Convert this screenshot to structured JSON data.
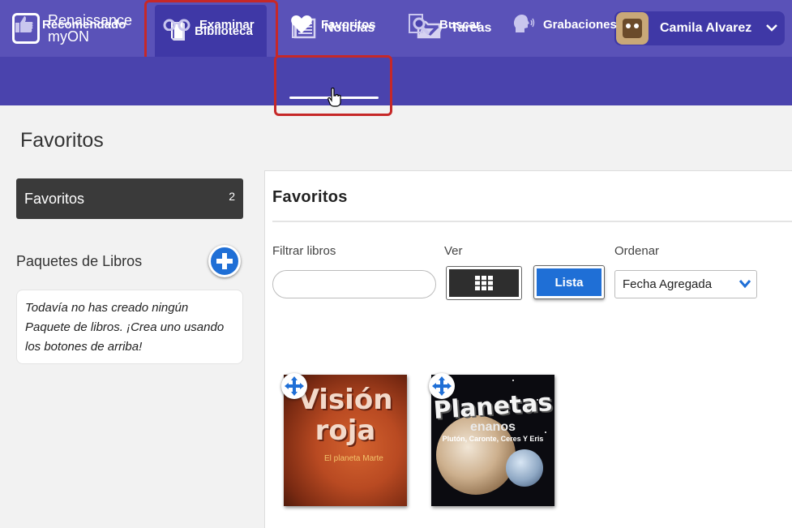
{
  "brand": {
    "line1": "Renaissance",
    "line2": "myON",
    "logo_letter": "m"
  },
  "topnav": {
    "items": [
      {
        "label": "Biblioteca",
        "icon": "book-icon"
      },
      {
        "label": "Noticias",
        "icon": "newspaper-icon"
      },
      {
        "label": "Tareas",
        "icon": "folder-icon"
      }
    ],
    "active": "Biblioteca"
  },
  "user": {
    "name": "Camila Alvarez",
    "icon": "chevron-down-icon"
  },
  "subnav": {
    "items": [
      {
        "label": "Recomendado",
        "icon": "thumbs-up-icon"
      },
      {
        "label": "Examinar",
        "icon": "glasses-icon"
      },
      {
        "label": "Favoritos",
        "icon": "heart-icon"
      },
      {
        "label": "Buscar",
        "icon": "search-icon"
      },
      {
        "label": "Grabaciones",
        "icon": "speaking-head-icon"
      }
    ],
    "active": "Favoritos"
  },
  "page": {
    "title": "Favoritos"
  },
  "sidebar": {
    "favorites": {
      "label": "Favoritos",
      "count": "2"
    },
    "packs": {
      "title": "Paquetes de Libros",
      "empty_text": "Todavía no has creado ningún Paquete de libros. ¡Crea uno usando los botones de arriba!"
    }
  },
  "main": {
    "title": "Favoritos",
    "filter": {
      "label": "Filtrar libros",
      "value": "",
      "placeholder": ""
    },
    "view": {
      "label": "Ver",
      "grid_icon": "grid-icon",
      "list_label": "Lista"
    },
    "sort": {
      "label": "Ordenar",
      "selected": "Fecha Agregada"
    }
  },
  "books": [
    {
      "title_line1": "Visión",
      "title_line2": "roja",
      "subtitle": "El planeta Marte"
    },
    {
      "title_line1": "Planetas",
      "title_line2": "enanos",
      "subtitle": "Plutón, Caronte, Ceres Y Eris"
    }
  ],
  "colors": {
    "topbar": "#5a52b8",
    "subbar": "#4a43ad",
    "active_tab": "#3f38a6",
    "highlight": "#c62828",
    "accent_blue": "#1f6fd6"
  }
}
